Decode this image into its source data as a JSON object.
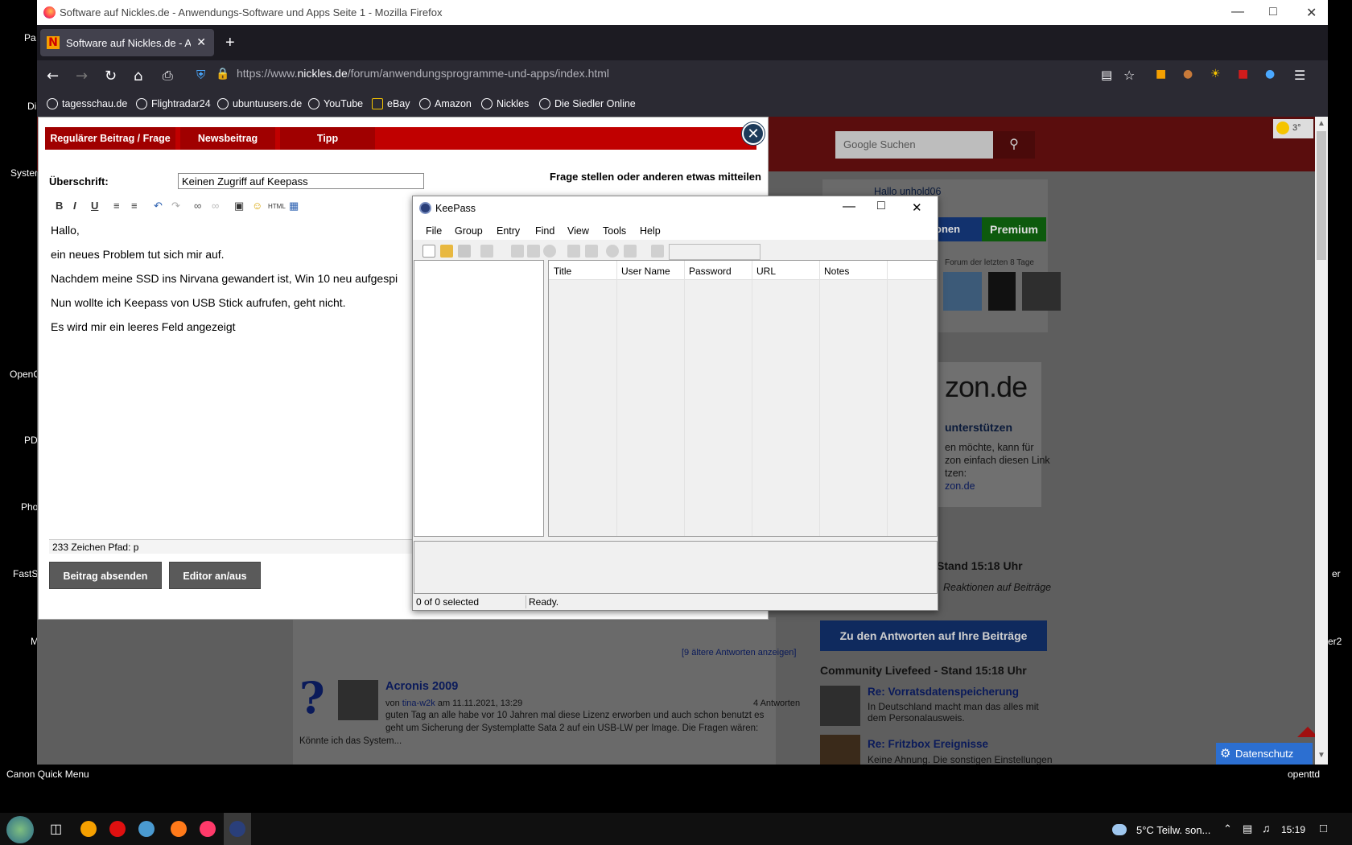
{
  "desktop": {
    "icons": [
      "Pa",
      "Di",
      "System",
      "OpenO",
      "PD",
      "Pho",
      "FastSt",
      "M",
      "Canon Quick Menu",
      "er",
      "er2",
      "openttd"
    ]
  },
  "window": {
    "title": "Software auf Nickles.de - Anwendungs-Software und Apps Seite 1 - Mozilla Firefox"
  },
  "tab": {
    "label": "Software auf Nickles.de - Anwen",
    "favicon": "N"
  },
  "url": {
    "prefix": "https://www.",
    "host": "nickles.de",
    "path": "/forum/anwendungsprogramme-und-apps/index.html"
  },
  "bookmarks": [
    "tagesschau.de",
    "Flightradar24",
    "ubuntuusers.de",
    "YouTube",
    "eBay",
    "Amazon",
    "Nickles",
    "Die Siedler Online"
  ],
  "modal": {
    "tabs": [
      "Regulärer Beitrag / Frage",
      "Newsbeitrag",
      "Tipp"
    ],
    "subject_label": "Überschrift:",
    "subject_value": "Keinen Zugriff auf Keepass",
    "hint": "Frage stellen oder anderen etwas mitteilen",
    "body_lines": [
      "Hallo,",
      "ein neues Problem tut sich mir auf.",
      "Nachdem meine SSD ins Nirvana gewandert ist, Win 10 neu aufgespi",
      "Nun wollte ich Keepass von USB Stick aufrufen, geht nicht.",
      "Es wird mir ein leeres Feld angezeigt"
    ],
    "status": "233 Zeichen Pfad: p",
    "submit": "Beitrag absenden",
    "toggle": "Editor an/aus"
  },
  "keepass": {
    "title": "KeePass",
    "menu": [
      "File",
      "Group",
      "Entry",
      "Find",
      "View",
      "Tools",
      "Help"
    ],
    "columns": [
      "Title",
      "User Name",
      "Password",
      "URL",
      "Notes"
    ],
    "status_left": "0 of 0 selected",
    "status_right": "Ready."
  },
  "page": {
    "search_placeholder": "Google Suchen",
    "greeting": "Hallo unhold06",
    "btn_left": "onen",
    "premium": "Premium",
    "forum_note": "Forum der letzten 8 Tage",
    "amazon_logo": "zon.de",
    "amazon_head": "unterstützen",
    "amazon_text": [
      "en möchte, kann für",
      "zon einfach diesen Link",
      "tzen:",
      "zon.de"
    ],
    "stand": "Stand 15:18 Uhr",
    "reactions": "Reaktionen auf Beiträge",
    "answers_btn": "Zu den Antworten auf Ihre Beiträge",
    "livefeed": "Community Livefeed - Stand 15:18 Uhr",
    "feed": [
      {
        "title": "Re: Vorratsdatenspeicherung",
        "text": "In Deutschland macht man das alles mit dem Personalausweis."
      },
      {
        "title": "Re: Fritzbox Ereignisse",
        "text": "Keine Ahnung. Die sonstigen Einstellungen"
      }
    ],
    "older": "[9 ältere Antworten anzeigen]",
    "post": {
      "title": "Acronis 2009",
      "by_prefix": "von ",
      "author": "tina-w2k",
      "date": " am 11.11.2021, 13:29",
      "answers": "4 Antworten",
      "text1": "guten Tag an alle habe vor 10 Jahren mal diese Lizenz erworben und auch schon benutzt es",
      "text2": "geht um Sicherung der Systemplatte Sata 2 auf ein USB-LW per Image. Die Fragen wären:",
      "text3": "Könnte ich das System..."
    },
    "datenschutz": "Datenschutz"
  },
  "taskbar": {
    "weather": "5°C  Teilw. son...",
    "time": "15:19"
  },
  "weather_badge": "3°"
}
